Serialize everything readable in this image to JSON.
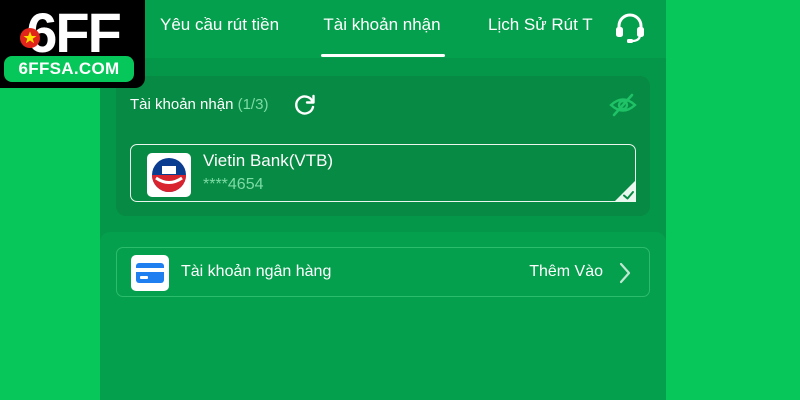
{
  "header": {
    "tabs": [
      {
        "label": "Yêu cầu rút tiền"
      },
      {
        "label": "Tài khoản nhận",
        "active": true
      },
      {
        "label": "Lịch Sử Rút T"
      }
    ],
    "support_icon": "headset-icon"
  },
  "brand": {
    "logo_mark": "6FF",
    "site": "6FFSA.COM",
    "accent": "#06c85a",
    "flag_red": "#e1251b",
    "flag_star": "#ffde00"
  },
  "accounts": {
    "title": "Tài khoản nhận",
    "count": "(1/3)",
    "refresh_icon": "refresh-icon",
    "visibility_icon": "eye-off-icon",
    "selected": {
      "bank_name": "Vietin Bank(VTB)",
      "number": "****4654",
      "logo_icon": "vietinbank-logo"
    }
  },
  "add_section": {
    "label": "Tài khoản ngân hàng",
    "action": "Thêm Vào",
    "icon": "bank-card-icon"
  },
  "colors": {
    "panel": "#059749",
    "card": "#078a43",
    "header": "#05a04d",
    "muted_green": "#7ddba6"
  }
}
